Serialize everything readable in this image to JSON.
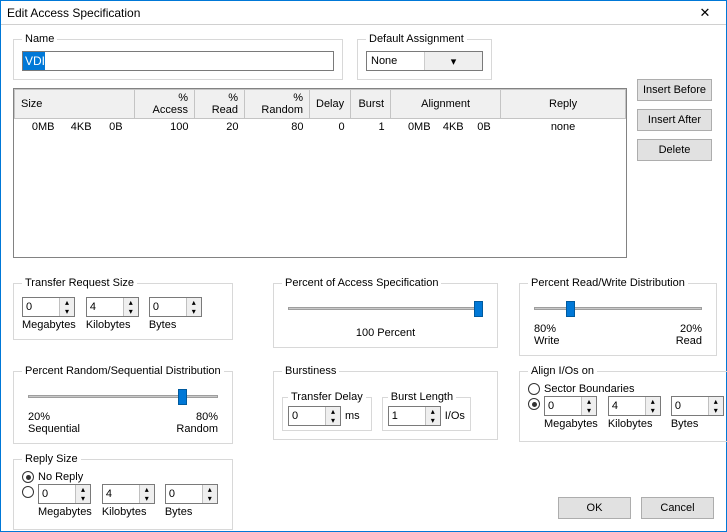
{
  "window": {
    "title": "Edit Access Specification"
  },
  "name": {
    "legend": "Name",
    "value": "VDI"
  },
  "default_assignment": {
    "legend": "Default Assignment",
    "value": "None"
  },
  "table": {
    "headers": {
      "size": "Size",
      "access": "% Access",
      "read": "% Read",
      "random": "% Random",
      "delay": "Delay",
      "burst": "Burst",
      "alignment": "Alignment",
      "reply": "Reply"
    },
    "row": {
      "size_mb": "0MB",
      "size_kb": "4KB",
      "size_b": "0B",
      "access": "100",
      "read": "20",
      "random": "80",
      "delay": "0",
      "burst": "1",
      "align_mb": "0MB",
      "align_kb": "4KB",
      "align_b": "0B",
      "reply": "none"
    }
  },
  "side": {
    "before": "Insert Before",
    "after": "Insert After",
    "delete": "Delete"
  },
  "transfer": {
    "legend": "Transfer Request Size",
    "mb": "0",
    "kb": "4",
    "b": "0",
    "mb_l": "Megabytes",
    "kb_l": "Kilobytes",
    "b_l": "Bytes"
  },
  "pct_access": {
    "legend": "Percent of Access Specification",
    "label": "100 Percent"
  },
  "pct_rw": {
    "legend": "Percent Read/Write Distribution",
    "left_pct": "80%",
    "left_lab": "Write",
    "right_pct": "20%",
    "right_lab": "Read"
  },
  "pct_rs": {
    "legend": "Percent Random/Sequential Distribution",
    "left_pct": "20%",
    "left_lab": "Sequential",
    "right_pct": "80%",
    "right_lab": "Random"
  },
  "burst": {
    "legend": "Burstiness",
    "delay_legend": "Transfer Delay",
    "delay_val": "0",
    "delay_unit": "ms",
    "len_legend": "Burst Length",
    "len_val": "1",
    "len_unit": "I/Os"
  },
  "align": {
    "legend": "Align I/Os on",
    "sector": "Sector Boundaries",
    "mb": "0",
    "kb": "4",
    "b": "0",
    "mb_l": "Megabytes",
    "kb_l": "Kilobytes",
    "b_l": "Bytes"
  },
  "reply": {
    "legend": "Reply Size",
    "noreply": "No Reply",
    "mb": "0",
    "kb": "4",
    "b": "0",
    "mb_l": "Megabytes",
    "kb_l": "Kilobytes",
    "b_l": "Bytes"
  },
  "buttons": {
    "ok": "OK",
    "cancel": "Cancel"
  }
}
